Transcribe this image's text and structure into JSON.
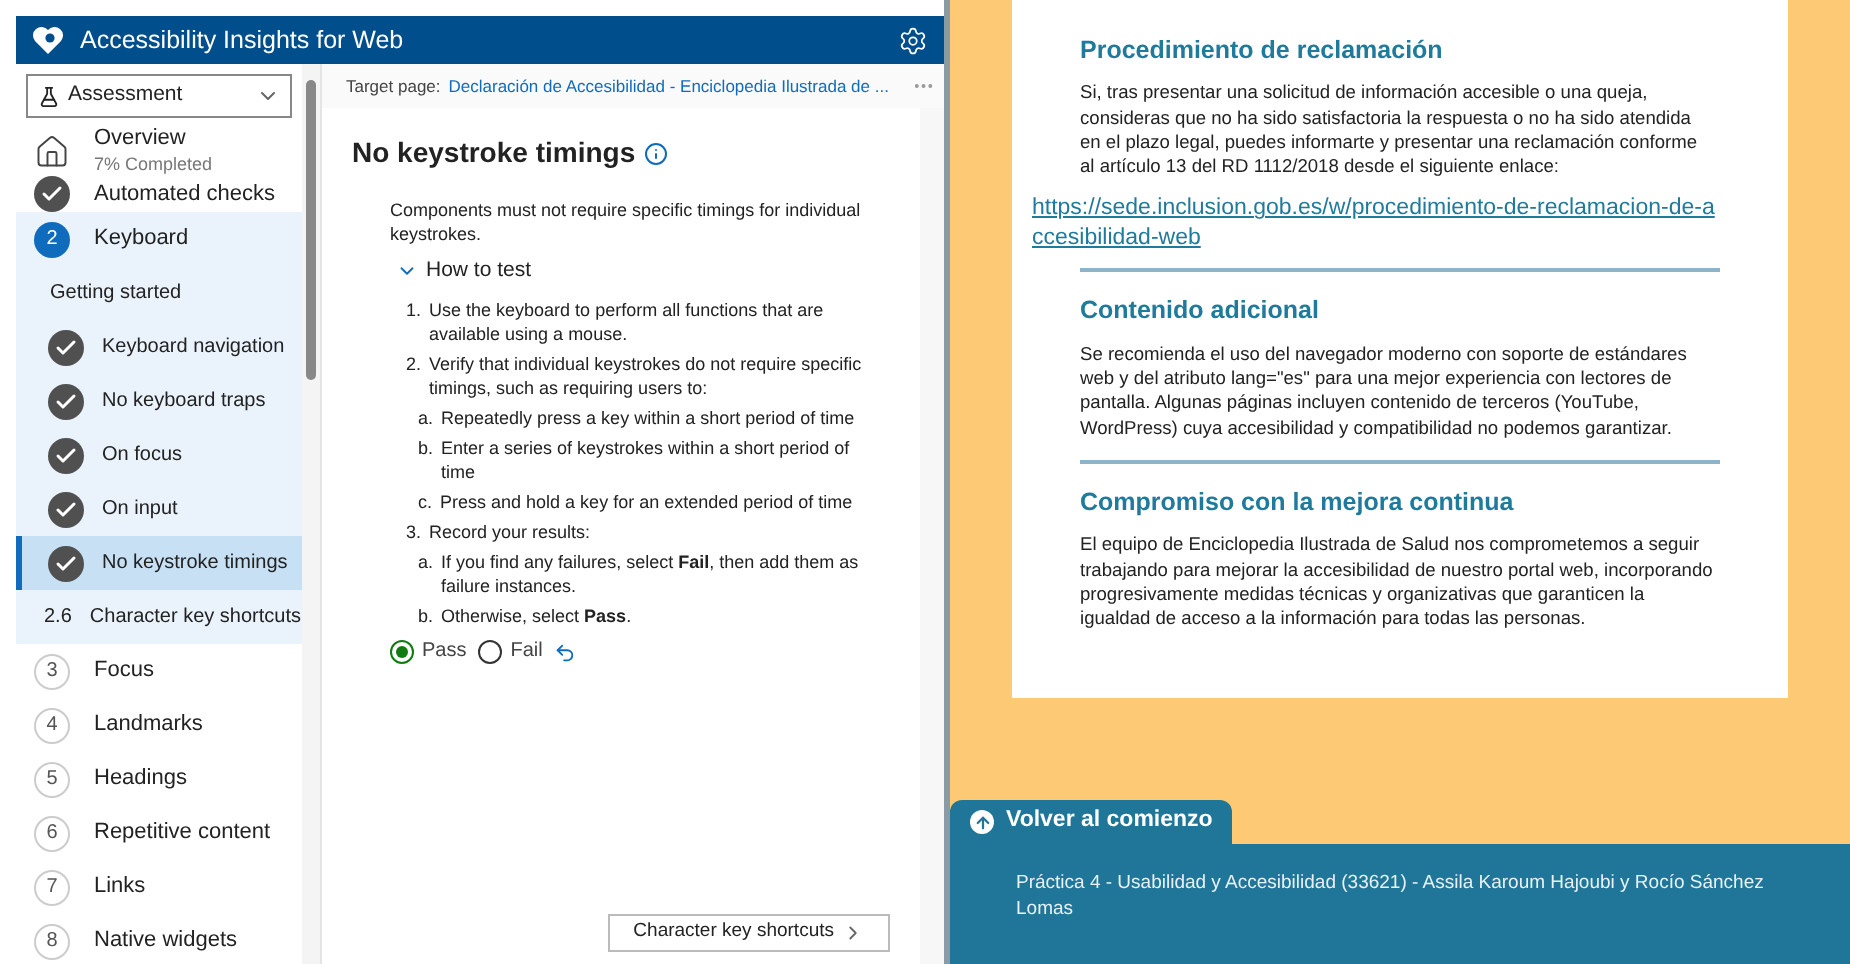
{
  "app": {
    "title": "Accessibility Insights for Web",
    "mode": "Assessment"
  },
  "nav": [
    {
      "kind": "overview",
      "label": "Overview",
      "sub": "7% Completed"
    },
    {
      "kind": "check",
      "label": "Automated checks",
      "done": true
    },
    {
      "kind": "step",
      "number": "2",
      "label": "Keyboard",
      "selected": true,
      "expanded": true,
      "children": [
        {
          "kind": "plain",
          "label": "Getting started",
          "selected": false
        },
        {
          "kind": "check",
          "label": "Keyboard navigation",
          "done": true,
          "selected": false
        },
        {
          "kind": "check",
          "label": "No keyboard traps",
          "done": true,
          "selected": false
        },
        {
          "kind": "check",
          "label": "On focus",
          "done": true,
          "selected": false
        },
        {
          "kind": "check",
          "label": "On input",
          "done": true,
          "selected": false
        },
        {
          "kind": "check",
          "label": "No keystroke timings",
          "done": true,
          "selected": true
        },
        {
          "kind": "numbered",
          "number": "2.6",
          "label": "Character key shortcuts",
          "selected": false
        }
      ]
    },
    {
      "kind": "step",
      "number": "3",
      "label": "Focus",
      "selected": false,
      "expanded": false
    },
    {
      "kind": "step",
      "number": "4",
      "label": "Landmarks",
      "selected": false,
      "expanded": false
    },
    {
      "kind": "step",
      "number": "5",
      "label": "Headings",
      "selected": false,
      "expanded": false
    },
    {
      "kind": "step",
      "number": "6",
      "label": "Repetitive content",
      "selected": false,
      "expanded": false
    },
    {
      "kind": "step",
      "number": "7",
      "label": "Links",
      "selected": false,
      "expanded": false
    },
    {
      "kind": "step",
      "number": "8",
      "label": "Native widgets",
      "selected": false,
      "expanded": false
    }
  ],
  "target": {
    "label": "Target page:",
    "link": "Declaración de Accesibilidad - Enciclopedia Ilustrada de ..."
  },
  "test": {
    "title": "No keystroke timings",
    "description": "Components must not require specific timings for individual keystrokes.",
    "how_to": {
      "label": "How to test",
      "expanded": true
    },
    "steps": [
      {
        "marker": "1.",
        "text": "Use the keyboard to perform all functions that are available using a mouse."
      },
      {
        "marker": "2.",
        "text": "Verify that individual keystrokes do not require specific timings, such as requiring users to:",
        "children": [
          {
            "marker": "a.",
            "text": "Repeatedly press a key within a short period of time"
          },
          {
            "marker": "b.",
            "text": "Enter a series of keystrokes within a short period of time"
          },
          {
            "marker": "c.",
            "text": "Press and hold a key for an extended period of time"
          }
        ]
      },
      {
        "marker": "3.",
        "text": "Record your results:",
        "children": [
          {
            "marker": "a.",
            "text": "If you find any failures, select **Fail**, then add them as failure instances."
          },
          {
            "marker": "b.",
            "text": "Otherwise, select **Pass**."
          }
        ]
      }
    ],
    "results": [
      {
        "label": "Pass",
        "selected": true
      },
      {
        "label": "Fail",
        "selected": false
      }
    ],
    "next_button": "Character key shortcuts"
  },
  "page": {
    "sections": [
      {
        "heading": "Procedimiento de reclamación",
        "text": "Si, tras presentar una solicitud de información accesible o una queja, consideras que no ha sido satisfactoria la respuesta o no ha sido atendida en el plazo legal, puedes informarte y presentar una reclamación conforme al artículo 13 del RD 1112/2018 desde el siguiente enlace:",
        "link": "https://sede.inclusion.gob.es/w/procedimiento-de-reclamacion-de-accesibilidad-web"
      },
      {
        "heading": "Contenido adicional",
        "text": "Se recomienda el uso del navegador moderno con soporte de estándares web y del atributo lang=\"es\" para una mejor experiencia con lectores de pantalla. Algunas páginas incluyen contenido de terceros (YouTube, WordPress) cuya accesibilidad y compatibilidad no podemos garantizar."
      },
      {
        "heading": "Compromiso con la mejora continua",
        "text": "El equipo de Enciclopedia Ilustrada de Salud nos comprometemos a seguir trabajando para mejorar la accesibilidad de nuestro portal web, incorporando progresivamente medidas técnicas y organizativas que garanticen la igualdad de acceso a la información para todas las personas."
      }
    ],
    "back_to_top": "Volver al comienzo",
    "footer": "Práctica 4 - Usabilidad y Accesibilidad (33621) - Assila Karoum Hajoubi y Rocío Sánchez Lomas"
  }
}
